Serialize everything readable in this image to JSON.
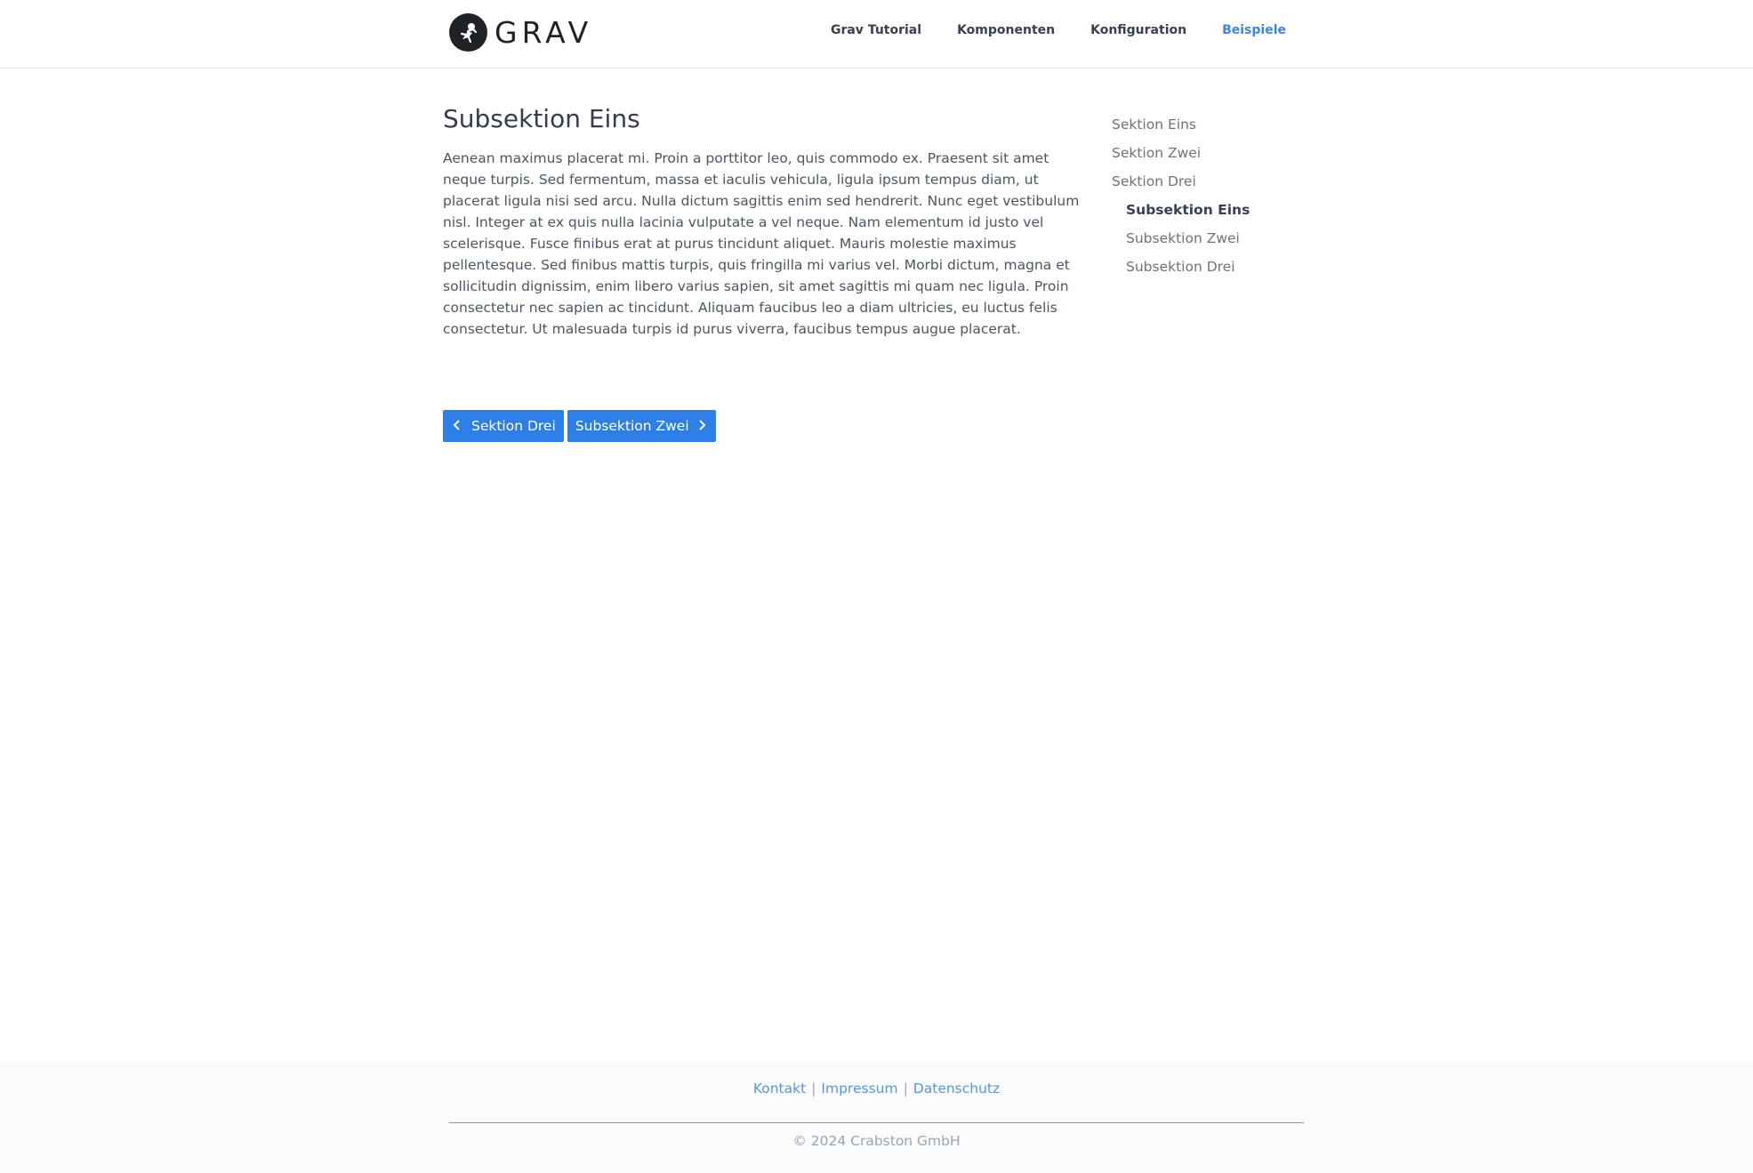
{
  "header": {
    "logo_text": "GRAV",
    "nav": [
      {
        "label": "Grav Tutorial",
        "active": false
      },
      {
        "label": "Komponenten",
        "active": false
      },
      {
        "label": "Konfiguration",
        "active": false
      },
      {
        "label": "Beispiele",
        "active": true
      }
    ]
  },
  "main": {
    "title": "Subsektion Eins",
    "body": "Aenean maximus placerat mi. Proin a porttitor leo, quis commodo ex. Praesent sit amet neque turpis. Sed fermentum, massa et iaculis vehicula, ligula ipsum tempus diam, ut placerat ligula nisi sed arcu. Nulla dictum sagittis enim sed hendrerit. Nunc eget vestibulum nisl. Integer at ex quis nulla lacinia vulputate a vel neque. Nam elementum id justo vel scelerisque. Fusce finibus erat at purus tincidunt aliquet. Mauris molestie maximus pellentesque. Sed finibus mattis turpis, quis fringilla mi varius vel. Morbi dictum, magna et sollicitudin dignissim, enim libero varius sapien, sit amet sagittis mi quam nec ligula. Proin consectetur nec sapien ac tincidunt. Aliquam faucibus leo a diam ultricies, eu luctus felis consectetur. Ut malesuada turpis id purus viverra, faucibus tempus augue placerat.",
    "prev_label": "Sektion Drei",
    "next_label": "Subsektion Zwei",
    "prev_icon": "chevron-left-icon",
    "next_icon": "chevron-right-icon",
    "accent_color": "#2d7ee6"
  },
  "toc": {
    "sections": [
      "Sektion Eins",
      "Sektion Zwei",
      "Sektion Drei"
    ],
    "subsections": [
      {
        "label": "Subsektion Eins",
        "current": true
      },
      {
        "label": "Subsektion Zwei",
        "current": false
      },
      {
        "label": "Subsektion Drei",
        "current": false
      }
    ]
  },
  "footer": {
    "links": [
      "Kontakt",
      "Impressum",
      "Datenschutz"
    ],
    "separator": "|",
    "copyright": "© 2024 Crabston GmbH"
  }
}
